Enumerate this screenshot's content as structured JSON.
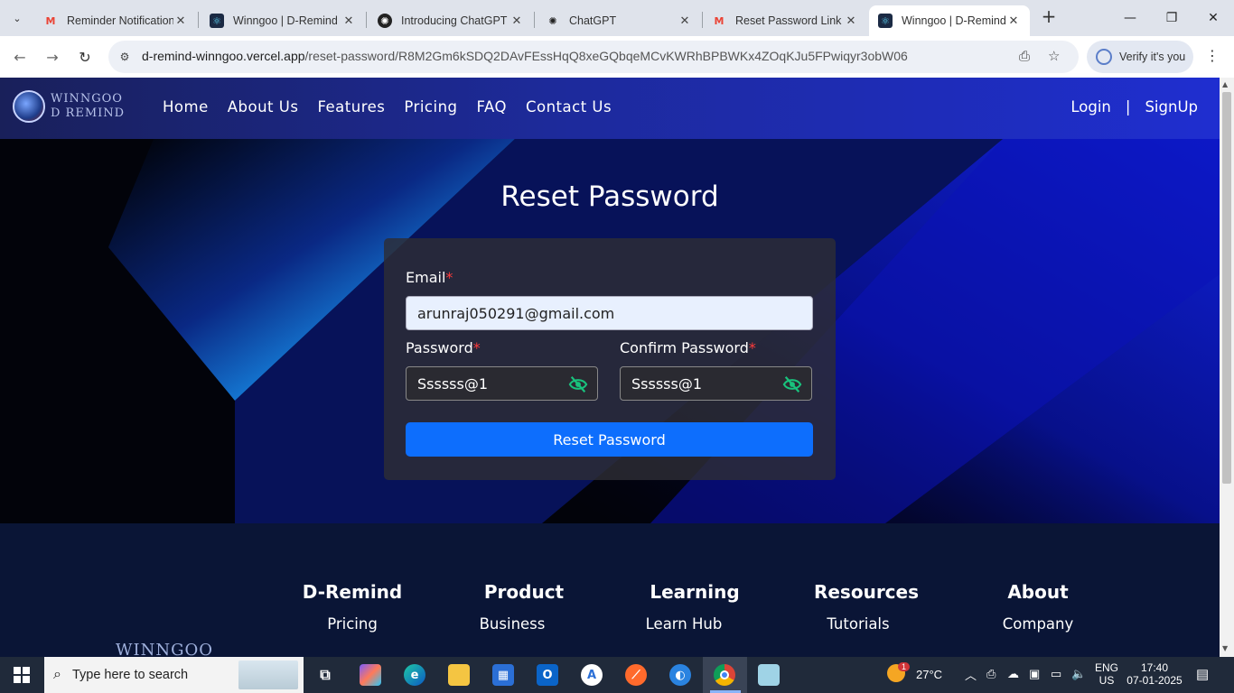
{
  "browser": {
    "tabs": [
      {
        "title": "Reminder Notification",
        "favicon": "gmail-icon",
        "active": false
      },
      {
        "title": "Winngoo | D-Remind",
        "favicon": "react-icon",
        "active": false
      },
      {
        "title": "Introducing ChatGPT",
        "favicon": "openai-icon",
        "active": false
      },
      {
        "title": "ChatGPT",
        "favicon": "openai-icon",
        "active": false
      },
      {
        "title": "Reset Password Link",
        "favicon": "gmail-icon",
        "active": false
      },
      {
        "title": "Winngoo | D-Remind",
        "favicon": "react-icon",
        "active": true
      }
    ],
    "url_host": "d-remind-winngoo.vercel.app",
    "url_path": "/reset-password/R8M2Gm6kSDQ2DAvFEssHqQ8xeGQbqeMCvKWRhBPBWKx4ZOqKJu5FPwiqyr3obW06",
    "verify_label": "Verify it's you"
  },
  "site": {
    "logo_line1": "WINNGOO",
    "logo_line2": "D REMIND",
    "nav": [
      "Home",
      "About Us",
      "Features",
      "Pricing",
      "FAQ",
      "Contact Us"
    ],
    "login": "Login",
    "separator": "|",
    "signup": "SignUp"
  },
  "form": {
    "heading": "Reset Password",
    "email_label": "Email",
    "email_value": "arunraj050291@gmail.com",
    "password_label": "Password",
    "password_value": "Ssssss@1",
    "confirm_label": "Confirm Password",
    "confirm_value": "Ssssss@1",
    "required_mark": "*",
    "submit_label": "Reset Password"
  },
  "footer": {
    "columns": [
      {
        "heading": "D-Remind",
        "first_link": "Pricing"
      },
      {
        "heading": "Product",
        "first_link": "Business"
      },
      {
        "heading": "Learning",
        "first_link": "Learn Hub"
      },
      {
        "heading": "Resources",
        "first_link": "Tutorials"
      },
      {
        "heading": "About",
        "first_link": "Company"
      }
    ],
    "logo_text": "WINNGOO"
  },
  "taskbar": {
    "search_placeholder": "Type here to search",
    "weather": "27°C",
    "weather_badge": "1",
    "lang_top": "ENG",
    "lang_bottom": "US",
    "time": "17:40",
    "date": "07-01-2025"
  },
  "colors": {
    "accent_button": "#0d6efd",
    "nav_gradient_end": "#1f2ed0",
    "required": "#ff3b3b",
    "eye_icon": "#19c37d"
  }
}
